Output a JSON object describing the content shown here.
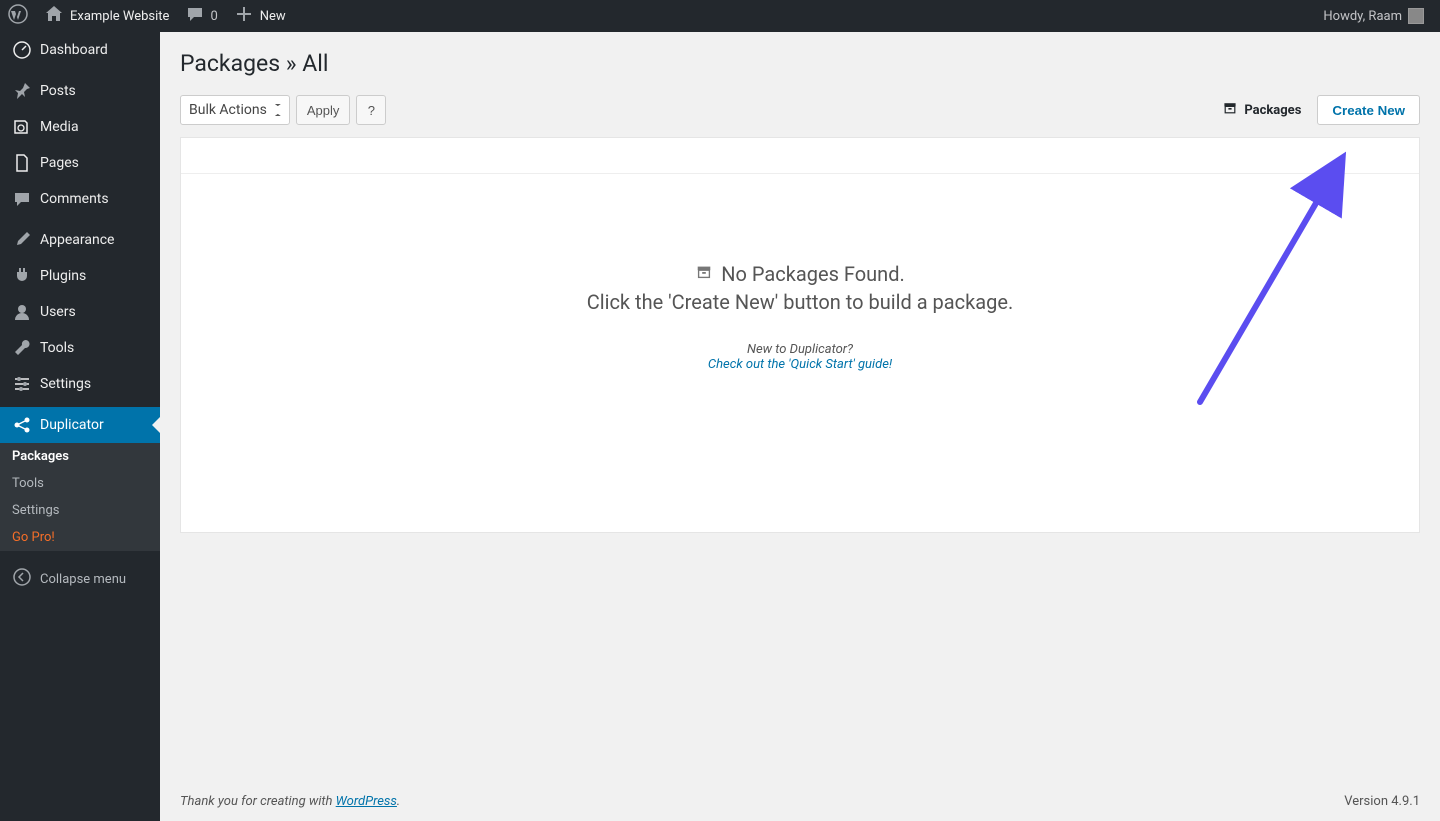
{
  "adminbar": {
    "site_name": "Example Website",
    "comment_count": "0",
    "new_label": "New",
    "howdy": "Howdy, Raam"
  },
  "sidebar": {
    "dashboard": "Dashboard",
    "posts": "Posts",
    "media": "Media",
    "pages": "Pages",
    "comments": "Comments",
    "appearance": "Appearance",
    "plugins": "Plugins",
    "users": "Users",
    "tools": "Tools",
    "settings": "Settings",
    "duplicator": "Duplicator",
    "sub_packages": "Packages",
    "sub_tools": "Tools",
    "sub_settings": "Settings",
    "sub_gopro": "Go Pro!",
    "collapse": "Collapse menu"
  },
  "page": {
    "title": "Packages » All",
    "bulk_actions": "Bulk Actions",
    "apply": "Apply",
    "help": "?",
    "tab_packages": "Packages",
    "create_new": "Create New"
  },
  "empty": {
    "title": "No Packages Found.",
    "subtitle": "Click the 'Create New' button to build a package.",
    "help_line": "New to Duplicator?",
    "help_link": "Check out the 'Quick Start' guide!"
  },
  "footer": {
    "thanks_prefix": "Thank you for creating with ",
    "wp_link": "WordPress",
    "period": ".",
    "version": "Version 4.9.1"
  }
}
